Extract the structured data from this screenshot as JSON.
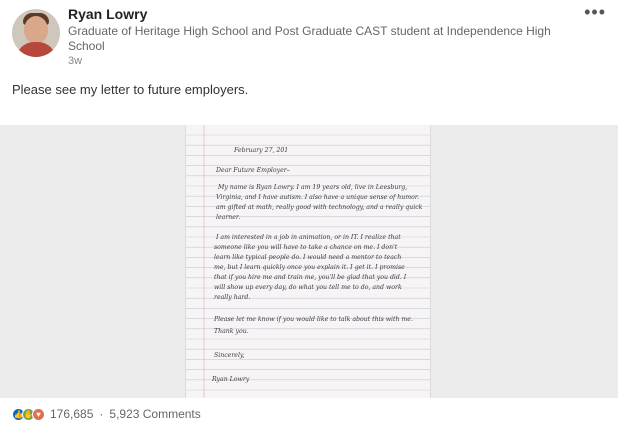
{
  "post": {
    "author": "Ryan Lowry",
    "headline": "Graduate of Heritage High School and Post Graduate CAST student at Independence High School",
    "time": "3w",
    "more": "•••",
    "text": "Please see my letter to future employers."
  },
  "letter": {
    "date": "February 27, 201",
    "greeting": "Dear Future Employer–",
    "p1": [
      "My name is Ryan Lowry. I am 19 years old, live in Leesburg,",
      "Virginia, and I have autism. I also have a unique sense of humor.",
      "am gifted at math, really good with technology, and a really quick",
      "learner."
    ],
    "p2": [
      "I am interested in a job in animation, or in IT. I realize that",
      "someone like you will have to take a chance on me. I don't",
      "learn like typical people do. I would need a mentor to teach",
      "me, but I learn quickly once you explain it. I get it. I promise",
      "that if you hire me and train me, you'll be glad that you did. I",
      "will show up every day, do what you tell me to do, and work",
      "really hard."
    ],
    "p3": [
      "Please let me know if you would like to talk about this with me.",
      "Thank you."
    ],
    "closing": "Sincerely,",
    "signature": "Ryan Lowry"
  },
  "social": {
    "reaction_icons": [
      "like-icon",
      "celebrate-icon",
      "love-icon"
    ],
    "reactions": "176,685",
    "separator": "·",
    "comments": "5,923 Comments"
  },
  "colors": {
    "like": "#0a66c2",
    "celebrate": "#6aa84f",
    "love": "#df704d"
  }
}
